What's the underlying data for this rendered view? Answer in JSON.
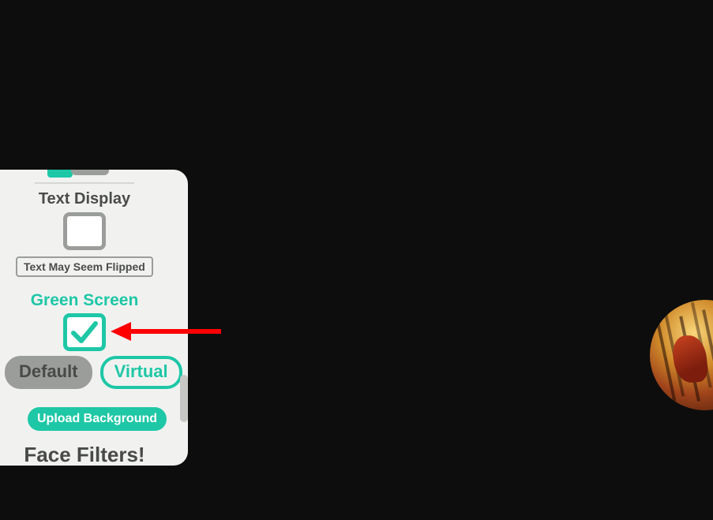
{
  "panel": {
    "text_display": {
      "title": "Text Display",
      "flip_note": "Text May Seem Flipped"
    },
    "green_screen": {
      "title": "Green Screen",
      "default_label": "Default",
      "virtual_label": "Virtual",
      "upload_label": "Upload Background"
    },
    "face_filters": {
      "title": "Face Filters!"
    }
  },
  "colors": {
    "accent": "#1ec7a6",
    "muted": "#9a9d99",
    "text": "#484a47",
    "annotation": "#ff0000"
  },
  "green_screen_checked": true,
  "text_display_checked": false
}
